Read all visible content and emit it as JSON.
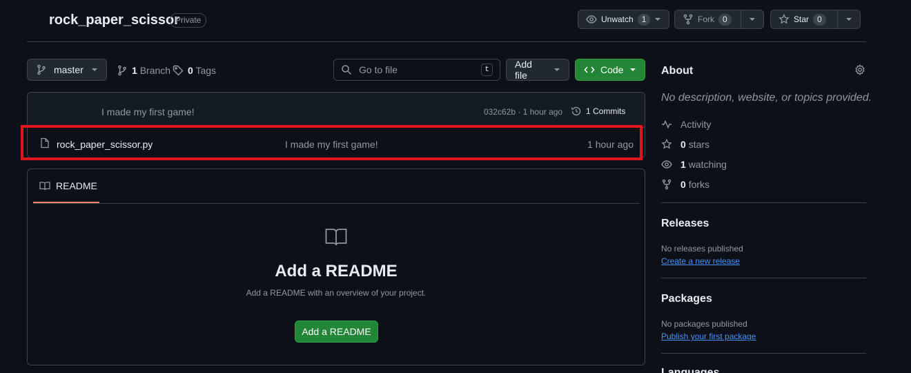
{
  "header": {
    "repo_name": "rock_paper_scissor",
    "visibility": "Private",
    "unwatch": {
      "label": "Unwatch",
      "count": "1"
    },
    "fork": {
      "label": "Fork",
      "count": "0"
    },
    "star": {
      "label": "Star",
      "count": "0"
    }
  },
  "toolbar": {
    "branch": "master",
    "branch_count": "1",
    "branch_label": "Branch",
    "tag_count": "0",
    "tag_label": "Tags",
    "goto_placeholder": "Go to file",
    "goto_shortcut": "t",
    "add_file": "Add file",
    "code": "Code"
  },
  "commit": {
    "message": "I made my first game!",
    "meta": "032c62b · 1 hour ago",
    "commits_label": "1 Commits"
  },
  "files": [
    {
      "name": "rock_paper_scissor.py",
      "message": "I made my first game!",
      "time": "1 hour ago"
    }
  ],
  "readme": {
    "tab": "README",
    "heading": "Add a README",
    "subtext": "Add a README with an overview of your project.",
    "button": "Add a README"
  },
  "sidebar": {
    "about_title": "About",
    "description": "No description, website, or topics provided.",
    "activity": "Activity",
    "stars_count": "0",
    "stars_label": "stars",
    "watching_count": "1",
    "watching_label": "watching",
    "forks_count": "0",
    "forks_label": "forks",
    "releases_title": "Releases",
    "releases_note": "No releases published",
    "releases_link": "Create a new release",
    "packages_title": "Packages",
    "packages_note": "No packages published",
    "packages_link": "Publish your first package",
    "languages_title": "Languages"
  },
  "colors": {
    "background": "#0d1117",
    "border": "#3d444d",
    "accent_green": "#238636",
    "link_blue": "#4493f8",
    "highlight_red": "#e0151d",
    "tab_underline": "#f78166"
  }
}
